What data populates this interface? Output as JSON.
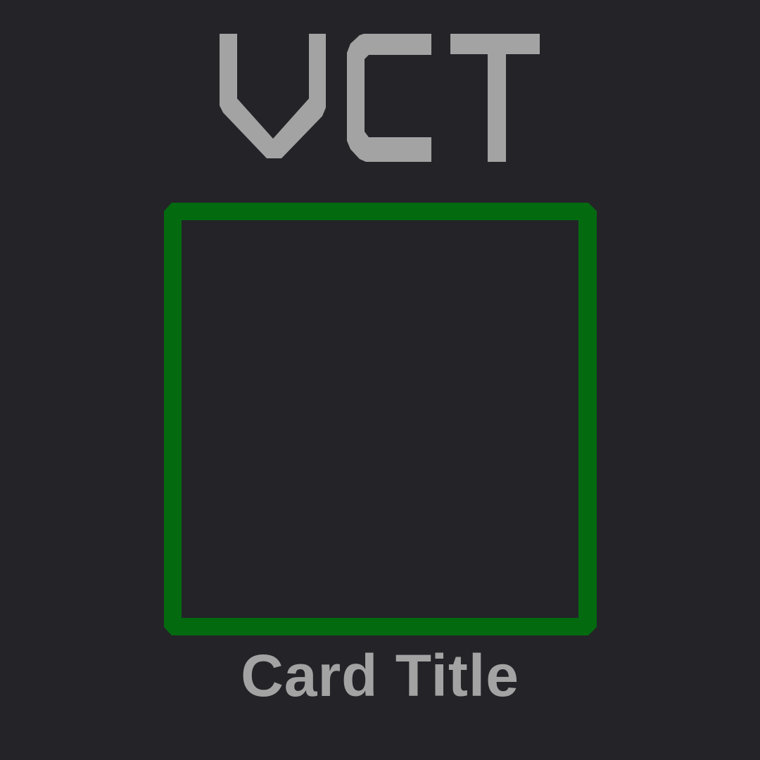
{
  "logo": {
    "text": "VCT"
  },
  "card": {
    "title": "Card Title"
  },
  "colors": {
    "background": "#242328",
    "text": "#a3a3a3",
    "frame": "#036a10"
  }
}
